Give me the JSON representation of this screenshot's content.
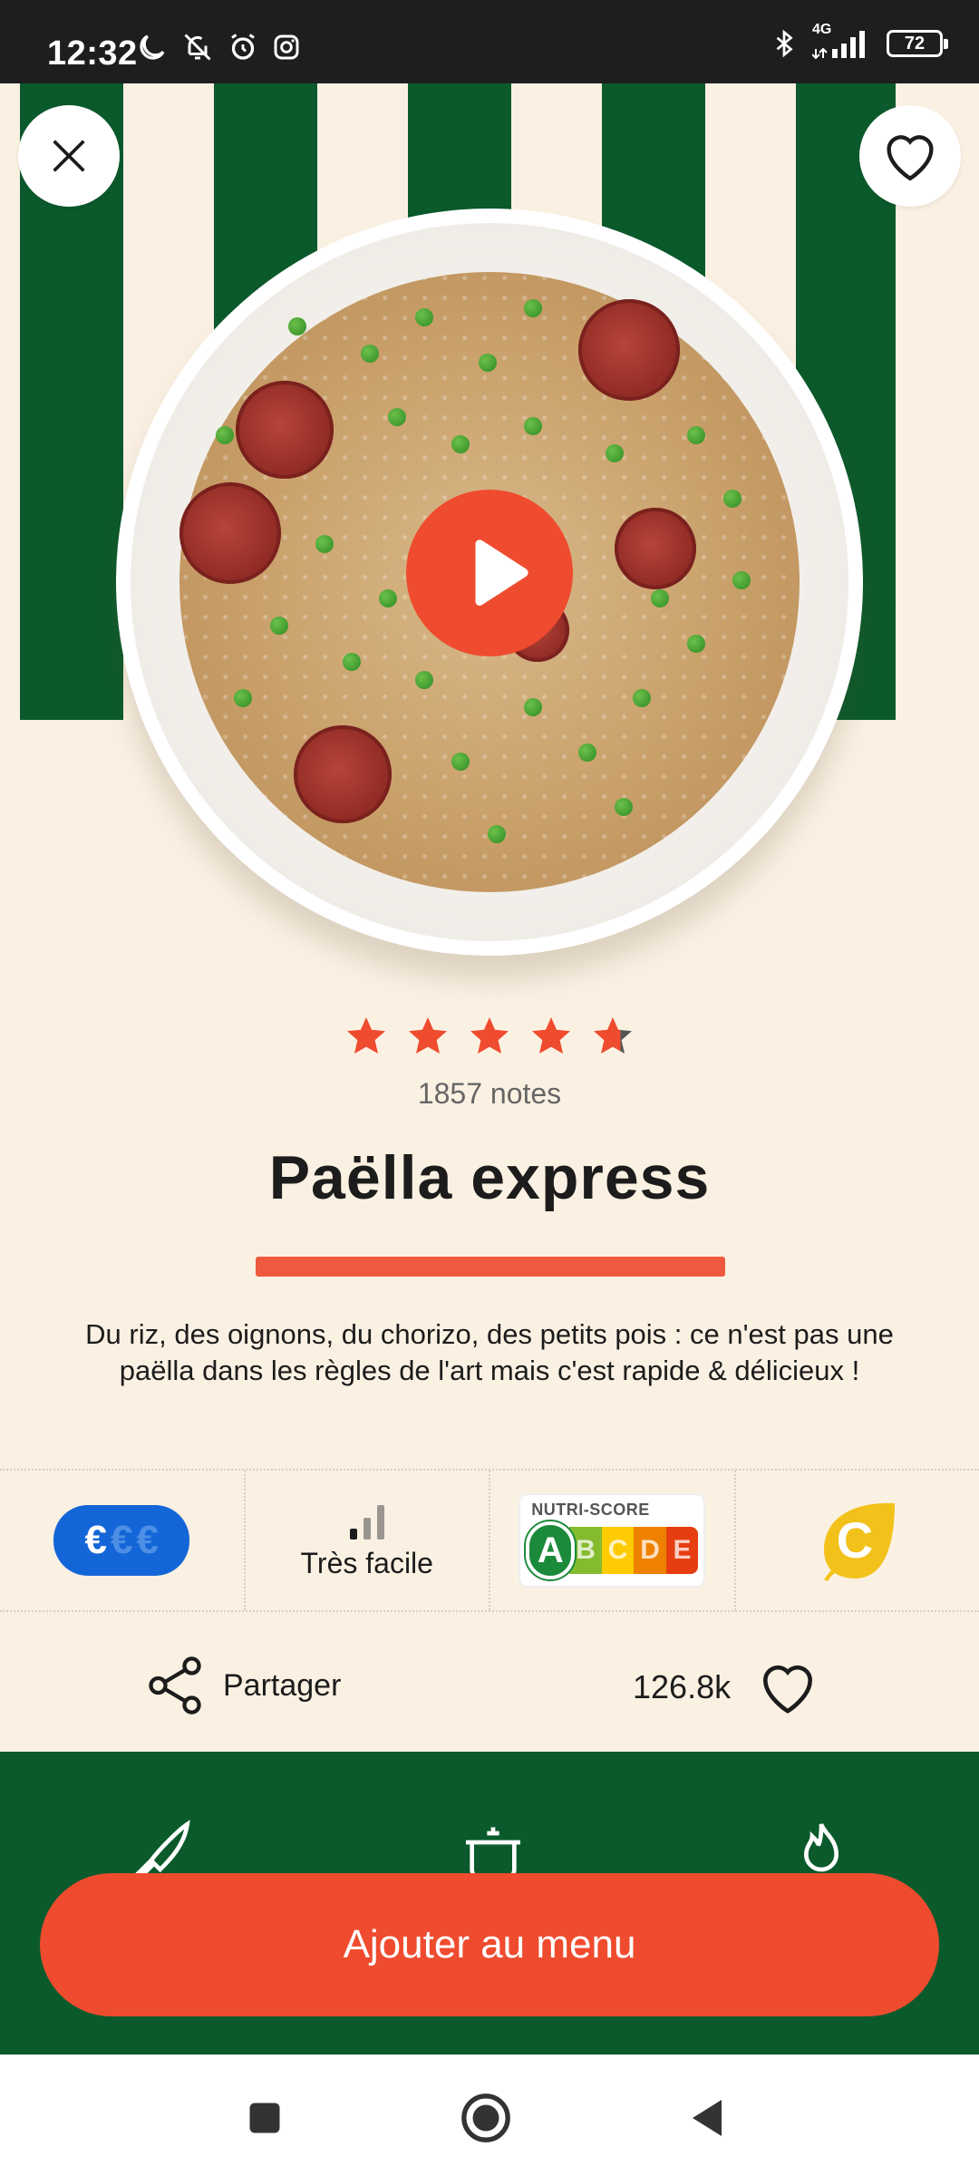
{
  "status_bar": {
    "time": "12:32",
    "network": "4G",
    "battery": "72",
    "icons": [
      "moon-icon",
      "bell-off-icon",
      "alarm-icon",
      "instagram-icon",
      "bluetooth-icon",
      "signal-icon",
      "battery-icon"
    ]
  },
  "hero": {
    "close_icon": "close-icon",
    "favorite_icon": "heart-outline-icon",
    "play_icon": "play-icon",
    "stripe_color": "#0b5a2c"
  },
  "recipe": {
    "rating": 4.7,
    "rating_count": "1857 notes",
    "title": "Paëlla express",
    "description": "Du riz, des oignons, du chorizo, des petits pois : ce n'est pas une paëlla dans les règles de l'art mais c'est rapide & délicieux !"
  },
  "info": {
    "price": {
      "level": 1,
      "max": 3,
      "symbol": "€"
    },
    "difficulty": {
      "label": "Très facile",
      "bars_filled": 1,
      "bars_total": 3
    },
    "nutriscore": {
      "label": "NUTRI-SCORE",
      "letters": [
        "A",
        "B",
        "C",
        "D",
        "E"
      ],
      "selected": "A"
    },
    "eco_score": {
      "letter": "C",
      "color": "#f2c21b"
    }
  },
  "actions": {
    "share_label": "Partager",
    "likes_count": "126.8k"
  },
  "green_section": {
    "icons": [
      "knife-icon",
      "pot-icon",
      "flame-icon"
    ]
  },
  "cta": {
    "label": "Ajouter au menu"
  },
  "colors": {
    "accent": "#ef4b2e",
    "green": "#0b5a2c",
    "background": "#fbf1e3",
    "price_blue": "#1466d8"
  },
  "nav": {
    "icons": [
      "recents-square-icon",
      "home-circle-icon",
      "back-triangle-icon"
    ]
  }
}
